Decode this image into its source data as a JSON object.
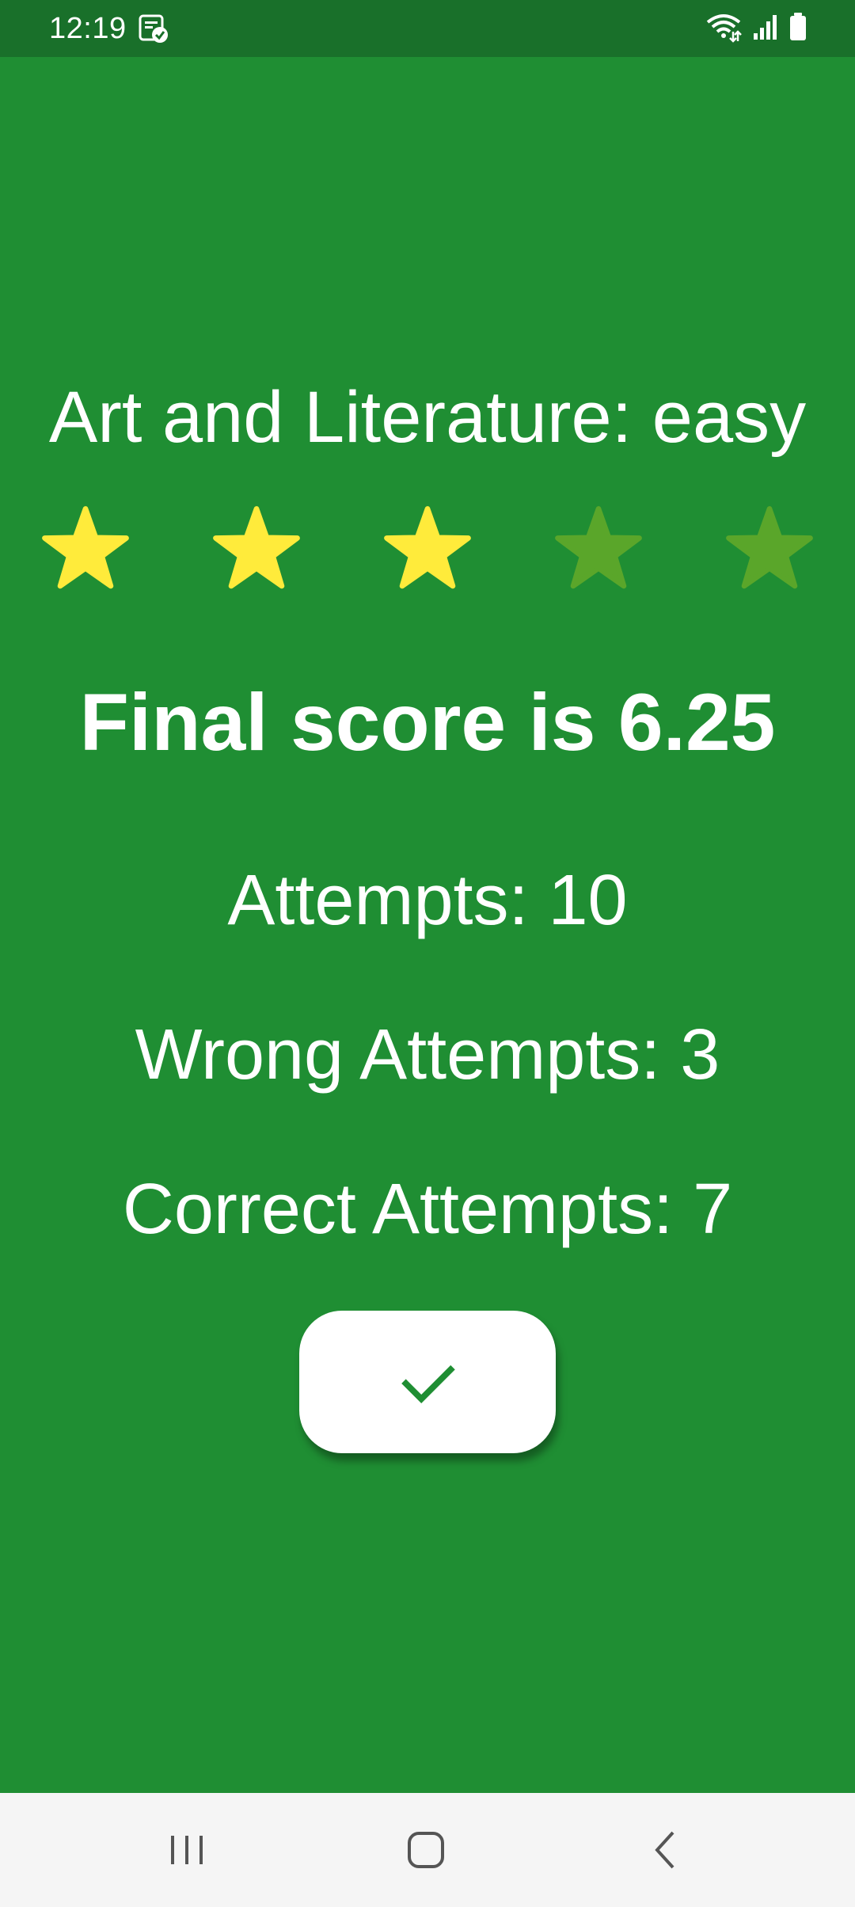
{
  "status_bar": {
    "time": "12:19",
    "notification_icon": "task-check-icon",
    "wifi_icon": "wifi-data-icon",
    "signal_icon": "cell-signal-icon",
    "battery_icon": "battery-icon"
  },
  "quiz": {
    "title": "Art and Literature: easy",
    "rating": {
      "filled": 3,
      "total": 5
    },
    "final_score": "Final score is 6.25",
    "attempts": "Attempts: 10",
    "wrong_attempts": "Wrong Attempts: 3",
    "correct_attempts": "Correct Attempts: 7",
    "confirm_icon": "check-icon"
  },
  "nav_bar": {
    "recents_icon": "recent-apps-icon",
    "home_icon": "home-icon",
    "back_icon": "back-icon"
  },
  "colors": {
    "background": "#1f8e33",
    "status_bar": "#19702a",
    "star_filled": "#ffeb3b",
    "star_empty": "#5aa62a",
    "text": "#ffffff",
    "nav_bar": "#f5f5f5"
  }
}
